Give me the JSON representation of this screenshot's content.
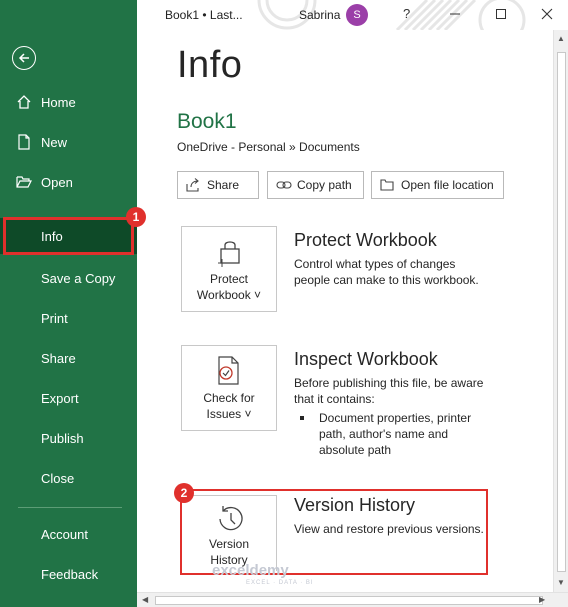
{
  "app": {
    "title": "Book1 • Last...",
    "user_name": "Sabrina",
    "user_initial": "S",
    "help": "?"
  },
  "sidebar": {
    "items": [
      {
        "label": "Home",
        "icon": "home-icon"
      },
      {
        "label": "New",
        "icon": "new-file-icon"
      },
      {
        "label": "Open",
        "icon": "open-folder-icon"
      },
      {
        "label": "Info"
      },
      {
        "label": "Save a Copy"
      },
      {
        "label": "Print"
      },
      {
        "label": "Share"
      },
      {
        "label": "Export"
      },
      {
        "label": "Publish"
      },
      {
        "label": "Close"
      },
      {
        "label": "Account"
      },
      {
        "label": "Feedback"
      }
    ],
    "active": "Info"
  },
  "main": {
    "title": "Info",
    "book_name": "Book1",
    "path": "OneDrive - Personal » Documents",
    "buttons": {
      "share": "Share",
      "copy_path": "Copy path",
      "open_location": "Open file location"
    },
    "protect": {
      "tile_line1": "Protect",
      "tile_line2": "Workbook ˅",
      "title": "Protect Workbook",
      "desc1": "Control what types of changes",
      "desc2": "people can make to this workbook."
    },
    "inspect": {
      "tile_line1": "Check for",
      "tile_line2": "Issues ˅",
      "title": "Inspect Workbook",
      "desc1": "Before publishing this file, be aware",
      "desc2": "that it contains:",
      "bullet1": "Document properties, printer",
      "bullet2": "path, author's name and",
      "bullet3": "absolute path"
    },
    "version": {
      "tile_line1": "Version",
      "tile_line2": "History",
      "title": "Version History",
      "desc": "View and restore previous versions."
    }
  },
  "annotations": {
    "marker1": "1",
    "marker2": "2",
    "highlight_color": "#e0302c"
  },
  "watermark": {
    "name": "exceldemy",
    "tagline": "EXCEL · DATA · BI"
  },
  "colors": {
    "sidebar": "#217346",
    "active": "#0e4a28",
    "accent": "#217346"
  }
}
